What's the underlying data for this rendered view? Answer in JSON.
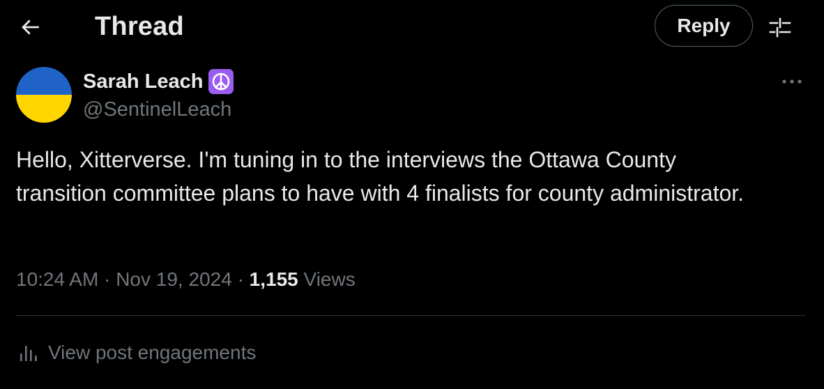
{
  "header": {
    "title": "Thread",
    "reply_label": "Reply"
  },
  "author": {
    "name": "Sarah Leach",
    "badge_emoji": "☮",
    "handle": "@SentinelLeach",
    "avatar_colors": [
      "#1f63c7",
      "#ffd500"
    ]
  },
  "post": {
    "text": "Hello, Xitterverse. I'm tuning in to the interviews the Ottawa County transition committee plans to have with 4 finalists for county administrator."
  },
  "meta": {
    "time": "10:24 AM",
    "separator": "·",
    "date": "Nov 19, 2024",
    "views_count": "1,155",
    "views_label": "Views"
  },
  "engagements": {
    "label": "View post engagements"
  },
  "colors": {
    "background": "#000000",
    "text_primary": "#e7e9ea",
    "text_secondary": "#71767b",
    "divider": "#2f3336",
    "badge": "#9b5cf0"
  }
}
